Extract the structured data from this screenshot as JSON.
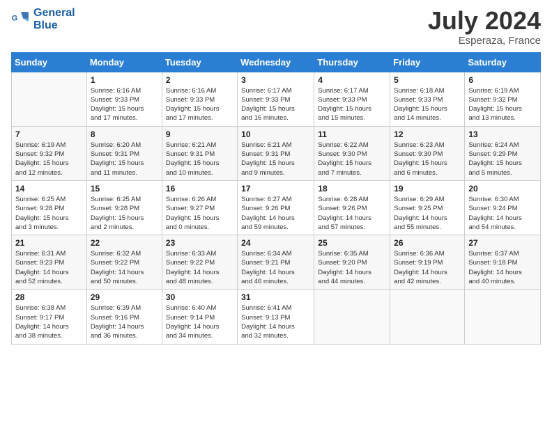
{
  "logo": {
    "line1": "General",
    "line2": "Blue"
  },
  "title": "July 2024",
  "location": "Esperaza, France",
  "weekdays": [
    "Sunday",
    "Monday",
    "Tuesday",
    "Wednesday",
    "Thursday",
    "Friday",
    "Saturday"
  ],
  "weeks": [
    [
      {
        "day": "",
        "info": ""
      },
      {
        "day": "1",
        "info": "Sunrise: 6:16 AM\nSunset: 9:33 PM\nDaylight: 15 hours\nand 17 minutes."
      },
      {
        "day": "2",
        "info": "Sunrise: 6:16 AM\nSunset: 9:33 PM\nDaylight: 15 hours\nand 17 minutes."
      },
      {
        "day": "3",
        "info": "Sunrise: 6:17 AM\nSunset: 9:33 PM\nDaylight: 15 hours\nand 16 minutes."
      },
      {
        "day": "4",
        "info": "Sunrise: 6:17 AM\nSunset: 9:33 PM\nDaylight: 15 hours\nand 15 minutes."
      },
      {
        "day": "5",
        "info": "Sunrise: 6:18 AM\nSunset: 9:33 PM\nDaylight: 15 hours\nand 14 minutes."
      },
      {
        "day": "6",
        "info": "Sunrise: 6:19 AM\nSunset: 9:32 PM\nDaylight: 15 hours\nand 13 minutes."
      }
    ],
    [
      {
        "day": "7",
        "info": "Sunrise: 6:19 AM\nSunset: 9:32 PM\nDaylight: 15 hours\nand 12 minutes."
      },
      {
        "day": "8",
        "info": "Sunrise: 6:20 AM\nSunset: 9:31 PM\nDaylight: 15 hours\nand 11 minutes."
      },
      {
        "day": "9",
        "info": "Sunrise: 6:21 AM\nSunset: 9:31 PM\nDaylight: 15 hours\nand 10 minutes."
      },
      {
        "day": "10",
        "info": "Sunrise: 6:21 AM\nSunset: 9:31 PM\nDaylight: 15 hours\nand 9 minutes."
      },
      {
        "day": "11",
        "info": "Sunrise: 6:22 AM\nSunset: 9:30 PM\nDaylight: 15 hours\nand 7 minutes."
      },
      {
        "day": "12",
        "info": "Sunrise: 6:23 AM\nSunset: 9:30 PM\nDaylight: 15 hours\nand 6 minutes."
      },
      {
        "day": "13",
        "info": "Sunrise: 6:24 AM\nSunset: 9:29 PM\nDaylight: 15 hours\nand 5 minutes."
      }
    ],
    [
      {
        "day": "14",
        "info": "Sunrise: 6:25 AM\nSunset: 9:28 PM\nDaylight: 15 hours\nand 3 minutes."
      },
      {
        "day": "15",
        "info": "Sunrise: 6:25 AM\nSunset: 9:28 PM\nDaylight: 15 hours\nand 2 minutes."
      },
      {
        "day": "16",
        "info": "Sunrise: 6:26 AM\nSunset: 9:27 PM\nDaylight: 15 hours\nand 0 minutes."
      },
      {
        "day": "17",
        "info": "Sunrise: 6:27 AM\nSunset: 9:26 PM\nDaylight: 14 hours\nand 59 minutes."
      },
      {
        "day": "18",
        "info": "Sunrise: 6:28 AM\nSunset: 9:26 PM\nDaylight: 14 hours\nand 57 minutes."
      },
      {
        "day": "19",
        "info": "Sunrise: 6:29 AM\nSunset: 9:25 PM\nDaylight: 14 hours\nand 55 minutes."
      },
      {
        "day": "20",
        "info": "Sunrise: 6:30 AM\nSunset: 9:24 PM\nDaylight: 14 hours\nand 54 minutes."
      }
    ],
    [
      {
        "day": "21",
        "info": "Sunrise: 6:31 AM\nSunset: 9:23 PM\nDaylight: 14 hours\nand 52 minutes."
      },
      {
        "day": "22",
        "info": "Sunrise: 6:32 AM\nSunset: 9:22 PM\nDaylight: 14 hours\nand 50 minutes."
      },
      {
        "day": "23",
        "info": "Sunrise: 6:33 AM\nSunset: 9:22 PM\nDaylight: 14 hours\nand 48 minutes."
      },
      {
        "day": "24",
        "info": "Sunrise: 6:34 AM\nSunset: 9:21 PM\nDaylight: 14 hours\nand 46 minutes."
      },
      {
        "day": "25",
        "info": "Sunrise: 6:35 AM\nSunset: 9:20 PM\nDaylight: 14 hours\nand 44 minutes."
      },
      {
        "day": "26",
        "info": "Sunrise: 6:36 AM\nSunset: 9:19 PM\nDaylight: 14 hours\nand 42 minutes."
      },
      {
        "day": "27",
        "info": "Sunrise: 6:37 AM\nSunset: 9:18 PM\nDaylight: 14 hours\nand 40 minutes."
      }
    ],
    [
      {
        "day": "28",
        "info": "Sunrise: 6:38 AM\nSunset: 9:17 PM\nDaylight: 14 hours\nand 38 minutes."
      },
      {
        "day": "29",
        "info": "Sunrise: 6:39 AM\nSunset: 9:16 PM\nDaylight: 14 hours\nand 36 minutes."
      },
      {
        "day": "30",
        "info": "Sunrise: 6:40 AM\nSunset: 9:14 PM\nDaylight: 14 hours\nand 34 minutes."
      },
      {
        "day": "31",
        "info": "Sunrise: 6:41 AM\nSunset: 9:13 PM\nDaylight: 14 hours\nand 32 minutes."
      },
      {
        "day": "",
        "info": ""
      },
      {
        "day": "",
        "info": ""
      },
      {
        "day": "",
        "info": ""
      }
    ]
  ]
}
